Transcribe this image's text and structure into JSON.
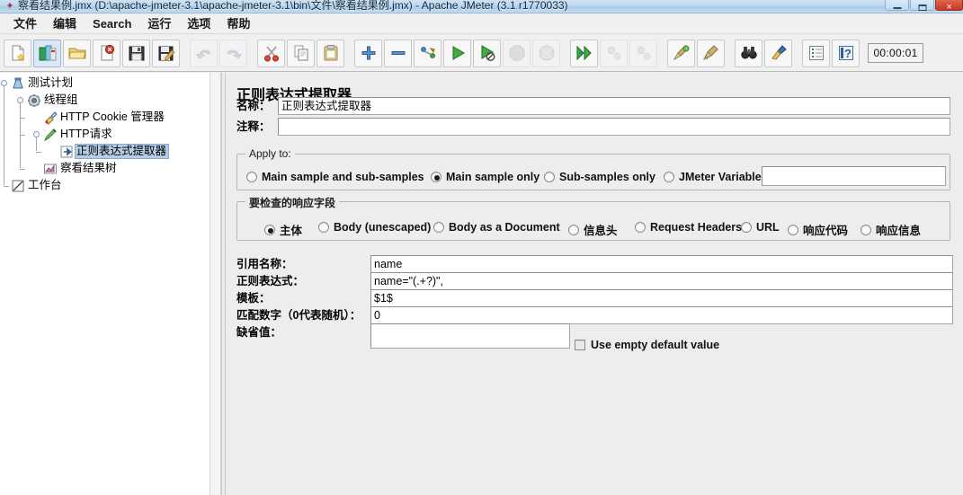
{
  "window": {
    "title": "察看结果例.jmx (D:\\apache-jmeter-3.1\\apache-jmeter-3.1\\bin\\文件\\察看结果例.jmx) - Apache JMeter (3.1 r1770033)",
    "app_icon": "jmeter-feather-icon",
    "controls": {
      "minimize": "minimize-button",
      "maximize": "maximize-button",
      "close": "close-button"
    },
    "accent_title_color": "#bcd8ee",
    "close_color": "#c1392a"
  },
  "menubar": {
    "items": [
      {
        "label": "文件",
        "name": "menu-file"
      },
      {
        "label": "编辑",
        "name": "menu-edit"
      },
      {
        "label": "Search",
        "name": "menu-search"
      },
      {
        "label": "运行",
        "name": "menu-run"
      },
      {
        "label": "选项",
        "name": "menu-options"
      },
      {
        "label": "帮助",
        "name": "menu-help"
      }
    ]
  },
  "toolbar": {
    "timer": "00:00:01",
    "buttons": [
      {
        "name": "new-button",
        "icon": "new-document-icon",
        "enabled": true,
        "selected": false
      },
      {
        "name": "templates-button",
        "icon": "templates-icon",
        "enabled": true,
        "selected": true
      },
      {
        "name": "open-button",
        "icon": "open-folder-icon",
        "enabled": true,
        "selected": false
      },
      {
        "name": "close-button",
        "icon": "close-document-icon",
        "enabled": true,
        "selected": false
      },
      {
        "name": "save-button",
        "icon": "floppy-save-icon",
        "enabled": true,
        "selected": false
      },
      {
        "name": "save-as-button",
        "icon": "save-as-icon",
        "enabled": true,
        "selected": false
      },
      {
        "name": "undo-button",
        "icon": "undo-arrow-icon",
        "enabled": false,
        "selected": false
      },
      {
        "name": "redo-button",
        "icon": "redo-arrow-icon",
        "enabled": false,
        "selected": false
      },
      {
        "name": "cut-button",
        "icon": "scissors-icon",
        "enabled": true,
        "selected": false
      },
      {
        "name": "copy-button",
        "icon": "copy-pages-icon",
        "enabled": true,
        "selected": false
      },
      {
        "name": "paste-button",
        "icon": "clipboard-paste-icon",
        "enabled": true,
        "selected": false
      },
      {
        "name": "expand-all-button",
        "icon": "plus-icon",
        "enabled": true,
        "selected": false
      },
      {
        "name": "collapse-all-button",
        "icon": "minus-icon",
        "enabled": true,
        "selected": false
      },
      {
        "name": "toggle-button",
        "icon": "toggle-node-icon",
        "enabled": true,
        "selected": false
      },
      {
        "name": "start-button",
        "icon": "play-green-icon",
        "enabled": true,
        "selected": false
      },
      {
        "name": "start-no-pauses-button",
        "icon": "play-no-pause-icon",
        "enabled": true,
        "selected": false
      },
      {
        "name": "stop-button",
        "icon": "stop-octagon-icon",
        "enabled": false,
        "selected": false
      },
      {
        "name": "shutdown-button",
        "icon": "shutdown-circle-icon",
        "enabled": false,
        "selected": false
      },
      {
        "name": "remote-start-all-button",
        "icon": "remote-start-icon",
        "enabled": true,
        "selected": false
      },
      {
        "name": "remote-stop-all-button",
        "icon": "remote-stop-icon",
        "enabled": false,
        "selected": false
      },
      {
        "name": "remote-shutdown-all-button",
        "icon": "remote-shutdown-icon",
        "enabled": false,
        "selected": false
      },
      {
        "name": "clear-button",
        "icon": "broom-clear-icon",
        "enabled": true,
        "selected": false
      },
      {
        "name": "clear-all-button",
        "icon": "broom-clear-all-icon",
        "enabled": true,
        "selected": false
      },
      {
        "name": "search-button",
        "icon": "binoculars-search-icon",
        "enabled": true,
        "selected": false
      },
      {
        "name": "reset-search-button",
        "icon": "brush-reset-icon",
        "enabled": true,
        "selected": false
      },
      {
        "name": "function-helper-button",
        "icon": "function-list-icon",
        "enabled": true,
        "selected": false
      },
      {
        "name": "help-button",
        "icon": "help-question-icon",
        "enabled": true,
        "selected": false
      }
    ]
  },
  "tree": {
    "nodes": [
      {
        "label": "测试计划",
        "name": "tree-node-test-plan",
        "icon": "test-plan-icon",
        "depth": 0,
        "selected": false
      },
      {
        "label": "线程组",
        "name": "tree-node-thread-group",
        "icon": "thread-group-gear-icon",
        "depth": 1,
        "selected": false
      },
      {
        "label": "HTTP Cookie 管理器",
        "name": "tree-node-http-cookie-manager",
        "icon": "cookie-manager-icon",
        "depth": 2,
        "selected": false
      },
      {
        "label": "HTTP请求",
        "name": "tree-node-http-request",
        "icon": "http-request-icon",
        "depth": 2,
        "selected": false
      },
      {
        "label": "正则表达式提取器",
        "name": "tree-node-regex-extractor",
        "icon": "post-processor-arrow-icon",
        "depth": 3,
        "selected": true
      },
      {
        "label": "察看结果树",
        "name": "tree-node-view-results-tree",
        "icon": "view-results-tree-icon",
        "depth": 2,
        "selected": false
      },
      {
        "label": "工作台",
        "name": "tree-node-workbench",
        "icon": "workbench-icon",
        "depth": 0,
        "selected": false
      }
    ],
    "selection_color": "#b5cde5"
  },
  "panel": {
    "title": "正则表达式提取器",
    "name_label": "名称：",
    "name_value": "正则表达式提取器",
    "comment_label": "注释：",
    "comment_value": "",
    "apply_to": {
      "title": "Apply to:",
      "options": [
        {
          "label": "Main sample and sub-samples",
          "name": "radio-main-and-sub-samples",
          "selected": false
        },
        {
          "label": "Main sample only",
          "name": "radio-main-sample-only",
          "selected": true
        },
        {
          "label": "Sub-samples only",
          "name": "radio-sub-samples-only",
          "selected": false
        },
        {
          "label": "JMeter Variable",
          "name": "radio-jmeter-variable",
          "selected": false
        }
      ],
      "variable_value": ""
    },
    "response_field": {
      "title": "要检查的响应字段",
      "options": [
        {
          "label": "主体",
          "name": "radio-body",
          "selected": true
        },
        {
          "label": "Body (unescaped)",
          "name": "radio-body-unescaped",
          "selected": false
        },
        {
          "label": "Body as a Document",
          "name": "radio-body-as-document",
          "selected": false
        },
        {
          "label": "信息头",
          "name": "radio-response-headers",
          "selected": false
        },
        {
          "label": "Request Headers",
          "name": "radio-request-headers",
          "selected": false
        },
        {
          "label": "URL",
          "name": "radio-url",
          "selected": false
        },
        {
          "label": "响应代码",
          "name": "radio-response-code",
          "selected": false
        },
        {
          "label": "响应信息",
          "name": "radio-response-message",
          "selected": false
        }
      ]
    },
    "fields": [
      {
        "label": "引用名称：",
        "value": "name",
        "name": "reference-name-field"
      },
      {
        "label": "正则表达式：",
        "value": "name=\"(.+?)\",",
        "name": "regular-expression-field"
      },
      {
        "label": "模板：",
        "value": "$1$",
        "name": "template-field"
      },
      {
        "label": "匹配数字（0代表随机）：",
        "value": "0",
        "name": "match-number-field"
      },
      {
        "label": "缺省值：",
        "value": "",
        "name": "default-value-field"
      }
    ],
    "use_empty_default": {
      "label": "Use empty default value",
      "checked": false,
      "name": "use-empty-default-checkbox"
    }
  }
}
